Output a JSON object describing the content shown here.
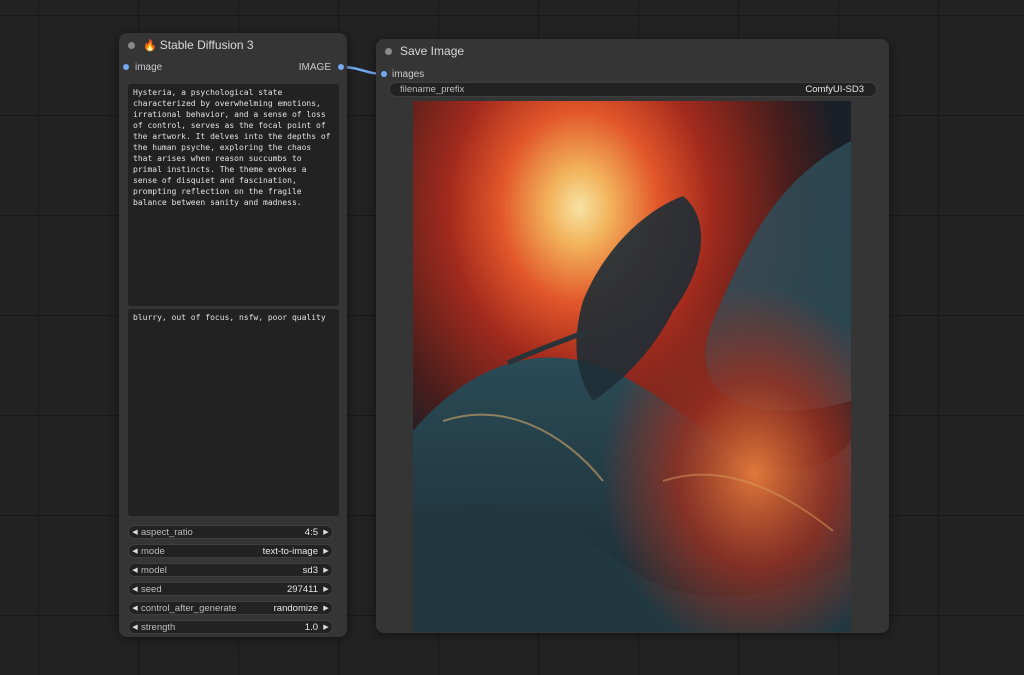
{
  "sd3_node": {
    "icon": "fire-icon",
    "title": "Stable Diffusion 3",
    "input_label": "image",
    "output_label": "IMAGE",
    "positive_prompt": "Hysteria, a psychological state characterized by overwhelming emotions, irrational behavior, and a sense of loss of control, serves as the focal point of the artwork. It delves into the depths of the human psyche, exploring the chaos that arises when reason succumbs to primal instincts. The theme evokes a sense of disquiet and fascination, prompting reflection on the fragile balance between sanity and madness.",
    "negative_prompt": "blurry, out of focus, nsfw, poor quality",
    "widgets": [
      {
        "label": "aspect_ratio",
        "value": "4:5"
      },
      {
        "label": "mode",
        "value": "text-to-image"
      },
      {
        "label": "model",
        "value": "sd3"
      },
      {
        "label": "seed",
        "value": "297411"
      },
      {
        "label": "control_after_generate",
        "value": "randomize"
      },
      {
        "label": "strength",
        "value": "1.0"
      }
    ]
  },
  "save_node": {
    "title": "Save Image",
    "input_label": "images",
    "filename_prefix_label": "filename_prefix",
    "filename_prefix_value": "ComfyUI-SD3"
  },
  "colors": {
    "slot_image": "#72a9f0",
    "node_bg": "#353535",
    "canvas_bg": "#222222"
  }
}
